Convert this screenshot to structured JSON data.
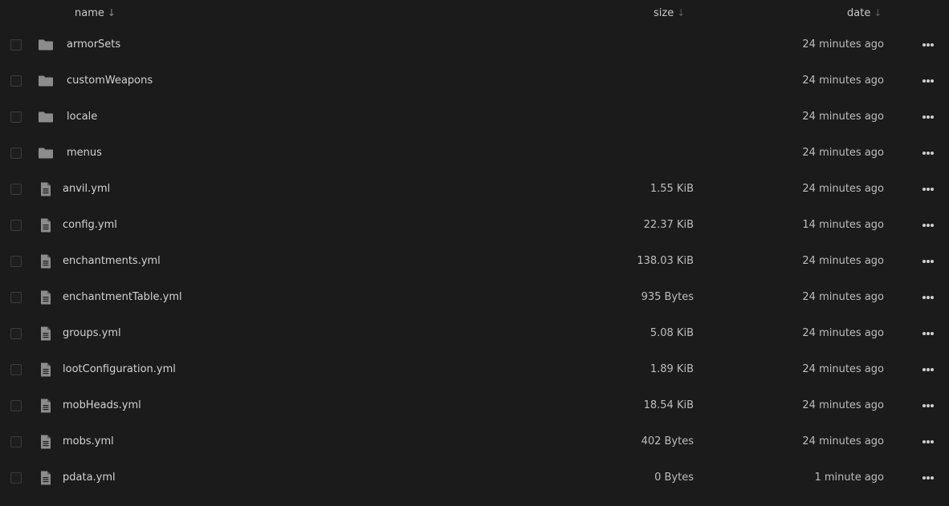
{
  "header": {
    "name_label": "name",
    "size_label": "size",
    "date_label": "date",
    "sort_arrow": "↓"
  },
  "colors": {
    "background": "#1b1b1c",
    "text": "#d2d2d2",
    "icon": "#8c8c8c"
  },
  "rows": [
    {
      "type": "folder",
      "icon": "folder-icon",
      "name": "armorSets",
      "size": "",
      "date": "24 minutes ago"
    },
    {
      "type": "folder",
      "icon": "folder-icon",
      "name": "customWeapons",
      "size": "",
      "date": "24 minutes ago"
    },
    {
      "type": "folder",
      "icon": "folder-icon",
      "name": "locale",
      "size": "",
      "date": "24 minutes ago"
    },
    {
      "type": "folder",
      "icon": "folder-icon",
      "name": "menus",
      "size": "",
      "date": "24 minutes ago"
    },
    {
      "type": "file",
      "icon": "file-icon",
      "name": "anvil.yml",
      "size": "1.55 KiB",
      "date": "24 minutes ago"
    },
    {
      "type": "file",
      "icon": "file-icon",
      "name": "config.yml",
      "size": "22.37 KiB",
      "date": "14 minutes ago"
    },
    {
      "type": "file",
      "icon": "file-icon",
      "name": "enchantments.yml",
      "size": "138.03 KiB",
      "date": "24 minutes ago"
    },
    {
      "type": "file",
      "icon": "file-icon",
      "name": "enchantmentTable.yml",
      "size": "935 Bytes",
      "date": "24 minutes ago"
    },
    {
      "type": "file",
      "icon": "file-icon",
      "name": "groups.yml",
      "size": "5.08 KiB",
      "date": "24 minutes ago"
    },
    {
      "type": "file",
      "icon": "file-icon",
      "name": "lootConfiguration.yml",
      "size": "1.89 KiB",
      "date": "24 minutes ago"
    },
    {
      "type": "file",
      "icon": "file-icon",
      "name": "mobHeads.yml",
      "size": "18.54 KiB",
      "date": "24 minutes ago"
    },
    {
      "type": "file",
      "icon": "file-icon",
      "name": "mobs.yml",
      "size": "402 Bytes",
      "date": "24 minutes ago"
    },
    {
      "type": "file",
      "icon": "file-icon",
      "name": "pdata.yml",
      "size": "0 Bytes",
      "date": "1 minute ago"
    }
  ]
}
